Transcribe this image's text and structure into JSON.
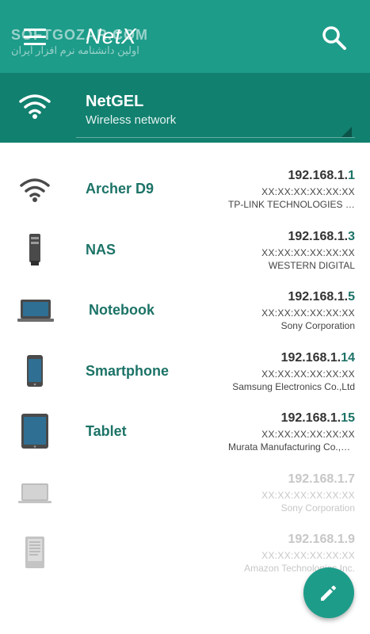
{
  "appbar": {
    "title": "NetX",
    "watermark": "SOFTGOZAR.COM",
    "watermark_sub": "اولین دانشنامه نرم افزار ایران",
    "menu_icon": "hamburger-menu-icon",
    "search_icon": "search-icon",
    "color": "#1e9c8a"
  },
  "network": {
    "name": "NetGEL",
    "subtitle": "Wireless network",
    "icon": "wifi-icon",
    "color": "#12806f"
  },
  "devices": [
    {
      "name": "Archer D9",
      "ip_prefix": "192.168.1.",
      "ip_last": "1",
      "mac": "XX:XX:XX:XX:XX:XX",
      "vendor": "TP-LINK TECHNOLOGIES CO.,LTD.",
      "icon": "wifi-router-icon",
      "online": true
    },
    {
      "name": "NAS",
      "ip_prefix": "192.168.1.",
      "ip_last": "3",
      "mac": "XX:XX:XX:XX:XX:XX",
      "vendor": "WESTERN DIGITAL",
      "icon": "nas-server-icon",
      "online": true
    },
    {
      "name": "Notebook",
      "ip_prefix": "192.168.1.",
      "ip_last": "5",
      "mac": "XX:XX:XX:XX:XX:XX",
      "vendor": "Sony Corporation",
      "icon": "laptop-icon",
      "online": true
    },
    {
      "name": "Smartphone",
      "ip_prefix": "192.168.1.",
      "ip_last": "14",
      "mac": "XX:XX:XX:XX:XX:XX",
      "vendor": "Samsung Electronics Co.,Ltd",
      "icon": "smartphone-icon",
      "online": true
    },
    {
      "name": "Tablet",
      "ip_prefix": "192.168.1.",
      "ip_last": "15",
      "mac": "XX:XX:XX:XX:XX:XX",
      "vendor": "Murata Manufacturing Co.,Ltd.",
      "icon": "tablet-icon",
      "online": true
    },
    {
      "name": "",
      "ip_prefix": "192.168.1.",
      "ip_last": "7",
      "mac": "XX:XX:XX:XX:XX:XX",
      "vendor": "Sony Corporation",
      "icon": "laptop-icon",
      "online": false
    },
    {
      "name": "",
      "ip_prefix": "192.168.1.",
      "ip_last": "9",
      "mac": "XX:XX:XX:XX:XX:XX",
      "vendor": "Amazon Technologies Inc.",
      "icon": "ereader-icon",
      "online": false
    }
  ],
  "fab": {
    "icon": "edit-pencil-icon"
  },
  "colors": {
    "accent": "#1c7367",
    "offline_text": "#c7c7c7"
  }
}
